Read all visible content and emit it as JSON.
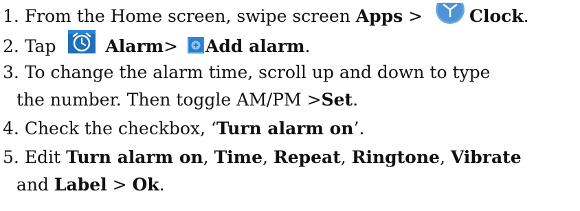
{
  "steps": [
    {
      "num": "1.",
      "text1": "From the Home screen, swipe screen ",
      "bold1": "Apps",
      "text2": " > ",
      "icon": "clock-app-icon",
      "bold2": "Clock",
      "text3": "."
    },
    {
      "num": "2.",
      "text1": "Tap ",
      "icon1": "alarm-icon",
      "bold1": "Alarm",
      "text2": "> ",
      "icon2": "add-alarm-icon",
      "bold2": "Add alarm",
      "text3": "."
    },
    {
      "num": "3.",
      "line1": "To change the alarm time, scroll up and down to type",
      "line2_text": "the number. Then toggle AM/PM >",
      "line2_bold": "Set",
      "line2_end": "."
    },
    {
      "num": "4.",
      "text1": "Check the checkbox, ‘",
      "bold1": "Turn alarm on",
      "text2": "’."
    },
    {
      "num": "5.",
      "text1": "Edit ",
      "b1": "Turn alarm on",
      "s1": ", ",
      "b2": "Time",
      "s2": ", ",
      "b3": "Repeat",
      "s3": ", ",
      "b4": "Ringtone",
      "s4": ", ",
      "b5": "Vibrate",
      "line2_text": "and ",
      "line2_b1": "Label",
      "line2_s1": " > ",
      "line2_b2": "Ok",
      "line2_end": "."
    }
  ],
  "colors": {
    "text": "#111111",
    "clock_icon": "#5b9bd8",
    "alarm_icon_bg": "#1f6fb8",
    "add_icon_bg": "#2a7fd0"
  }
}
